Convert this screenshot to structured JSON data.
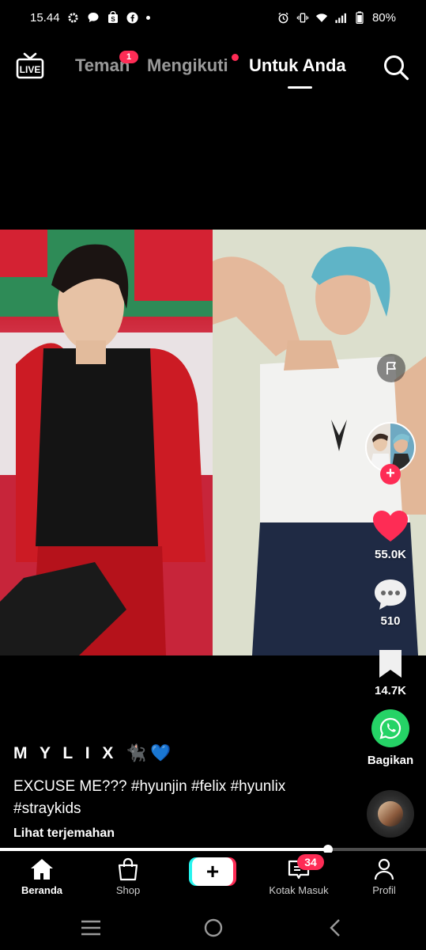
{
  "status_bar": {
    "time": "15.44",
    "battery": "80%",
    "left_icons": [
      "settings-icon",
      "chat-bubble-icon",
      "shopee-icon",
      "facebook-icon"
    ],
    "right_icons": [
      "alarm-icon",
      "vibrate-icon",
      "wifi-icon",
      "signal-icon",
      "battery-icon"
    ]
  },
  "top_nav": {
    "live_label": "LIVE",
    "tabs": [
      {
        "label": "Teman",
        "badge": "1"
      },
      {
        "label": "Mengikuti",
        "has_dot": true
      },
      {
        "label": "Untuk Anda",
        "active": true
      }
    ]
  },
  "video": {
    "actions": {
      "like_count": "55.0K",
      "comment_count": "510",
      "save_count": "14.7K",
      "share_label": "Bagikan"
    },
    "author": "M Y L I X 🐈‍⬛💙",
    "caption": "EXCUSE ME??? #hyunjin #felix #hyunlix #straykids",
    "translate_label": "Lihat terjemahan",
    "progress": 0.77
  },
  "bottom_nav": {
    "items": [
      {
        "label": "Beranda",
        "active": true
      },
      {
        "label": "Shop"
      },
      {
        "label": "+"
      },
      {
        "label": "Kotak Masuk",
        "badge": "34"
      },
      {
        "label": "Profil"
      }
    ]
  },
  "colors": {
    "accent": "#fe2c55",
    "cyan": "#25f4ee",
    "whatsapp": "#25d366",
    "like": "#fe2c55"
  }
}
